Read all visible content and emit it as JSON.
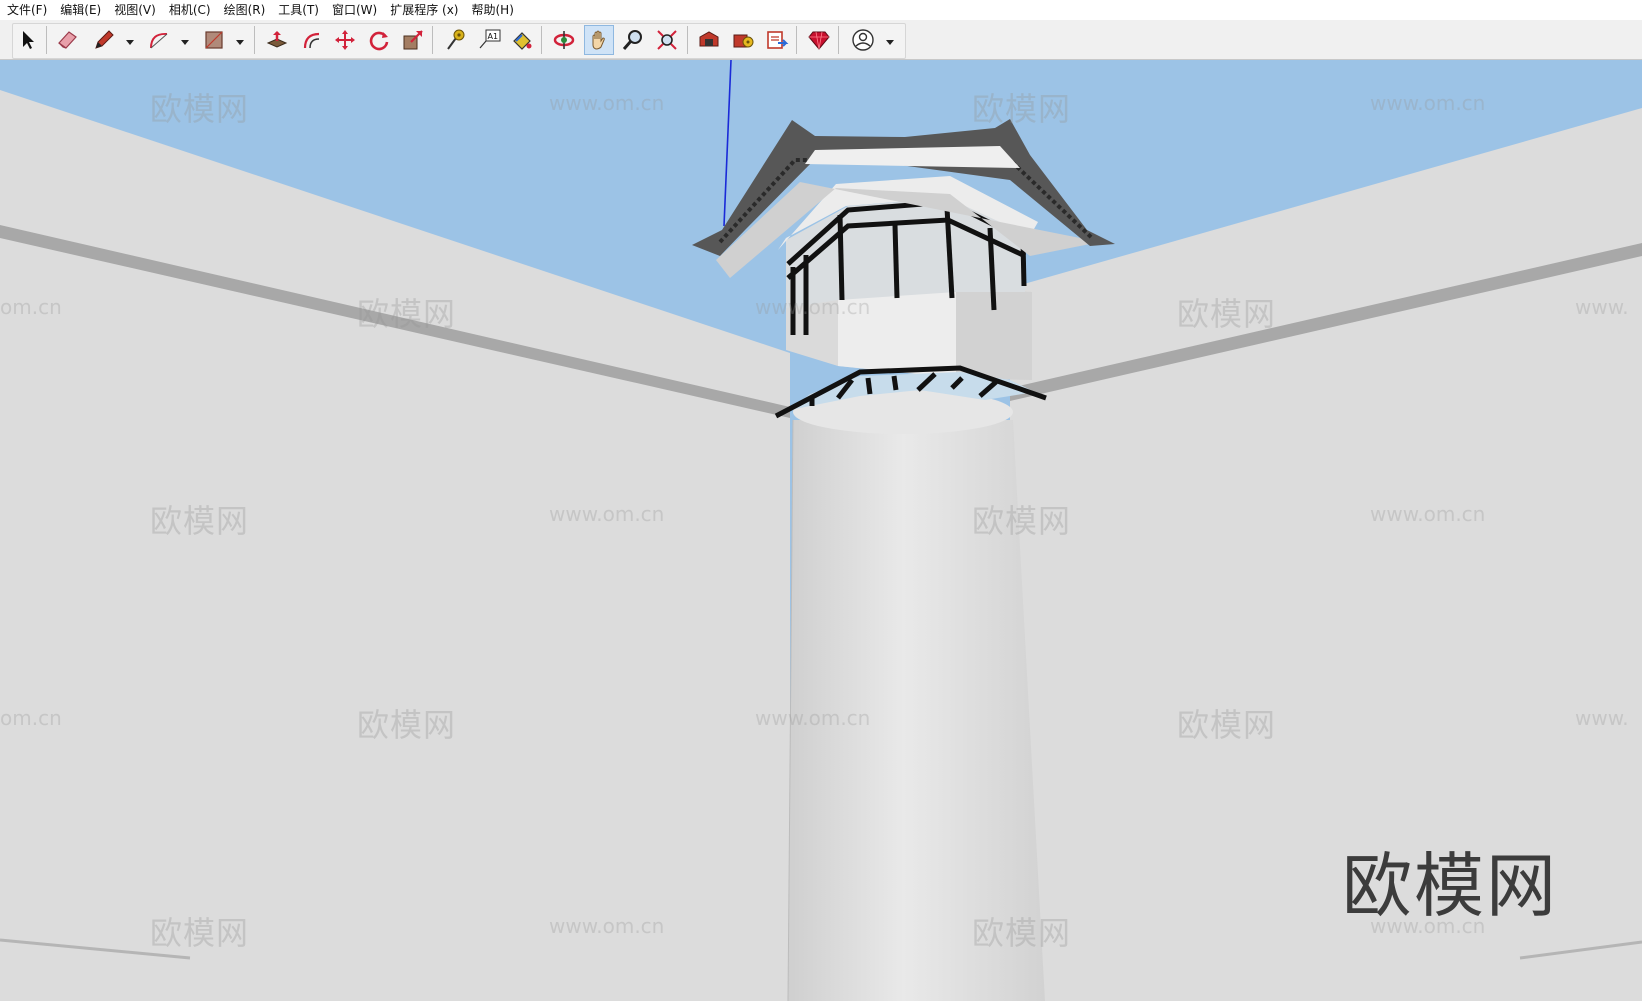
{
  "menu": [
    {
      "id": "file",
      "label": "文件(F)"
    },
    {
      "id": "edit",
      "label": "编辑(E)"
    },
    {
      "id": "view",
      "label": "视图(V)"
    },
    {
      "id": "camera",
      "label": "相机(C)"
    },
    {
      "id": "draw",
      "label": "绘图(R)"
    },
    {
      "id": "tools",
      "label": "工具(T)"
    },
    {
      "id": "window",
      "label": "窗口(W)"
    },
    {
      "id": "extensions",
      "label": "扩展程序 (x)"
    },
    {
      "id": "help",
      "label": "帮助(H)"
    }
  ],
  "toolbar": {
    "tools": [
      {
        "name": "select-tool",
        "icon": "select-arrow-icon"
      },
      {
        "name": "eraser-tool",
        "icon": "eraser-icon"
      },
      {
        "name": "line-tool",
        "icon": "pencil-icon"
      },
      {
        "name": "arc-tool",
        "icon": "arc-icon"
      },
      {
        "name": "rectangle-tool",
        "icon": "rectangle-icon"
      },
      {
        "name": "push-pull-tool",
        "icon": "push-pull-icon"
      },
      {
        "name": "offset-tool",
        "icon": "offset-icon"
      },
      {
        "name": "move-tool",
        "icon": "move-icon"
      },
      {
        "name": "rotate-tool",
        "icon": "rotate-icon"
      },
      {
        "name": "scale-tool",
        "icon": "scale-icon"
      },
      {
        "name": "tape-measure-tool",
        "icon": "tape-measure-icon"
      },
      {
        "name": "text-tool",
        "icon": "text-label-icon"
      },
      {
        "name": "paint-bucket-tool",
        "icon": "paint-bucket-icon"
      },
      {
        "name": "orbit-tool",
        "icon": "orbit-icon"
      },
      {
        "name": "pan-tool",
        "icon": "hand-icon"
      },
      {
        "name": "zoom-tool",
        "icon": "magnifier-icon"
      },
      {
        "name": "zoom-extents-tool",
        "icon": "zoom-extents-icon"
      },
      {
        "name": "3d-warehouse-button",
        "icon": "warehouse-icon"
      },
      {
        "name": "extension-warehouse-button",
        "icon": "extension-warehouse-icon"
      },
      {
        "name": "send-to-layout-button",
        "icon": "layout-icon"
      },
      {
        "name": "ruby-console-button",
        "icon": "ruby-gem-icon"
      },
      {
        "name": "account-button",
        "icon": "user-profile-icon"
      }
    ],
    "active_tool": "pan-tool",
    "text_tool_glyph": "A1"
  },
  "watermark": {
    "brand": "欧模网",
    "url": "www.om.cn",
    "partial_url": "om.cn",
    "partial_url_right": "www.",
    "large_brand": "欧模网"
  },
  "colors": {
    "sky": "#9cc3e6",
    "wall": "#dcdcdc",
    "wall_band": "#a9a9a9",
    "roof_tile": "#555555",
    "window_frame": "#111111",
    "blue_axis": "#1a2ad8"
  }
}
